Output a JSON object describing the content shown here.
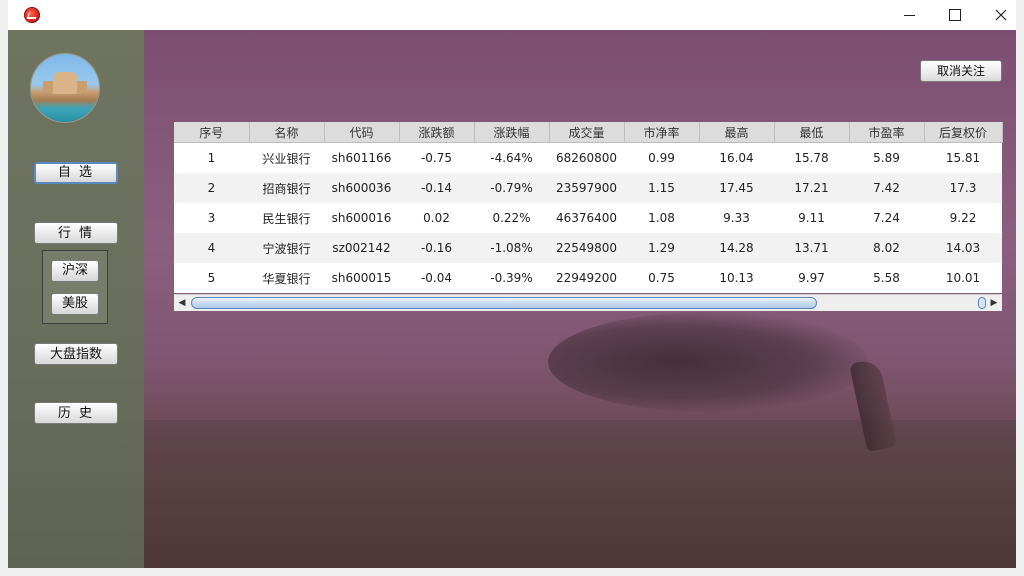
{
  "window": {
    "app_icon": "stock-app-icon",
    "controls": [
      "minimize-icon",
      "maximize-icon",
      "close-icon"
    ]
  },
  "sidebar": {
    "avatar": "avatar-image",
    "buttons": {
      "zixuan": "自 选",
      "hangqing": "行 情",
      "dapan": "大盘指数",
      "lishi": "历 史"
    },
    "sub_buttons": {
      "hushen": "沪深",
      "meigu": "美股"
    }
  },
  "toolbar": {
    "unfollow_label": "取消关注"
  },
  "table": {
    "columns": [
      "序号",
      "名称",
      "代码",
      "涨跌额",
      "涨跌幅",
      "成交量",
      "市净率",
      "最高",
      "最低",
      "市盈率",
      "后复权价"
    ],
    "rows": [
      {
        "idx": "1",
        "name": "兴业银行",
        "code": "sh601166",
        "change": "-0.75",
        "pct": "-4.64%",
        "volume": "68260800",
        "pb": "0.99",
        "high": "16.04",
        "low": "15.78",
        "pe": "5.89",
        "adj": "15.81"
      },
      {
        "idx": "2",
        "name": "招商银行",
        "code": "sh600036",
        "change": "-0.14",
        "pct": "-0.79%",
        "volume": "23597900",
        "pb": "1.15",
        "high": "17.45",
        "low": "17.21",
        "pe": "7.42",
        "adj": "17.3"
      },
      {
        "idx": "3",
        "name": "民生银行",
        "code": "sh600016",
        "change": "0.02",
        "pct": "0.22%",
        "volume": "46376400",
        "pb": "1.08",
        "high": "9.33",
        "low": "9.11",
        "pe": "7.24",
        "adj": "9.22"
      },
      {
        "idx": "4",
        "name": "宁波银行",
        "code": "sz002142",
        "change": "-0.16",
        "pct": "-1.08%",
        "volume": "22549800",
        "pb": "1.29",
        "high": "14.28",
        "low": "13.71",
        "pe": "8.02",
        "adj": "14.03"
      },
      {
        "idx": "5",
        "name": "华夏银行",
        "code": "sh600015",
        "change": "-0.04",
        "pct": "-0.39%",
        "volume": "22949200",
        "pb": "0.75",
        "high": "10.13",
        "low": "9.97",
        "pe": "5.58",
        "adj": "10.01"
      }
    ]
  },
  "colors": {
    "negative": "#1e7a1e",
    "positive": "#b01818",
    "accent": "#5b87c2"
  }
}
